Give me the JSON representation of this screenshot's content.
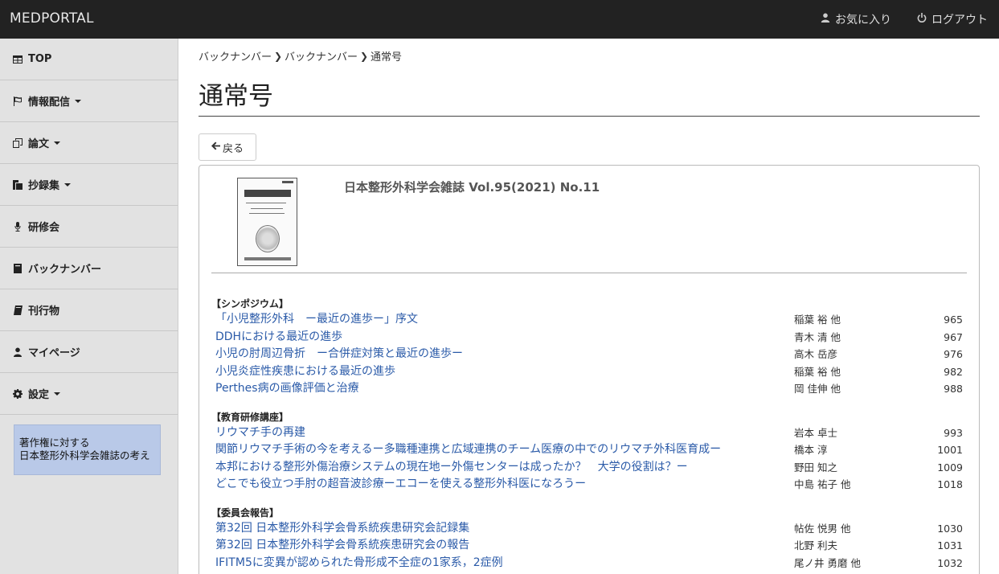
{
  "header": {
    "brand": "MEDPORTAL",
    "favorites_label": "お気に入り",
    "logout_label": "ログアウト"
  },
  "sidebar": {
    "items": [
      {
        "label": "TOP",
        "icon": "table-icon",
        "has_caret": false
      },
      {
        "label": "情報配信",
        "icon": "flag-icon",
        "has_caret": true
      },
      {
        "label": "論文",
        "icon": "copy-icon",
        "has_caret": true
      },
      {
        "label": "抄録集",
        "icon": "files-icon",
        "has_caret": true
      },
      {
        "label": "研修会",
        "icon": "microphone-icon",
        "has_caret": false
      },
      {
        "label": "バックナンバー",
        "icon": "book-icon",
        "has_caret": false
      },
      {
        "label": "刊行物",
        "icon": "book-open-icon",
        "has_caret": false
      },
      {
        "label": "マイページ",
        "icon": "user-icon",
        "has_caret": false
      },
      {
        "label": "設定",
        "icon": "gear-icon",
        "has_caret": true
      }
    ],
    "copyright_line1": "著作権に対する",
    "copyright_line2": "日本整形外科学会雑誌の考え"
  },
  "breadcrumb": [
    "バックナンバー",
    "バックナンバー",
    "通常号"
  ],
  "page_title": "通常号",
  "back_button": "戻る",
  "journal": {
    "title": "日本整形外科学会雑誌 Vol.95(2021) No.11"
  },
  "toc": [
    {
      "heading": "【シンポジウム】",
      "articles": [
        {
          "title": "「小児整形外科　ー最近の進歩ー」序文",
          "authors": "稲葉 裕 他",
          "page": "965"
        },
        {
          "title": "DDHにおける最近の進歩",
          "authors": "青木 清 他",
          "page": "967"
        },
        {
          "title": "小児の肘周辺骨折　ー合併症対策と最近の進歩ー",
          "authors": "高木 岳彦",
          "page": "976"
        },
        {
          "title": "小児炎症性疾患における最近の進歩",
          "authors": "稲葉 裕 他",
          "page": "982"
        },
        {
          "title": "Perthes病の画像評価と治療",
          "authors": "岡 佳伸 他",
          "page": "988"
        }
      ]
    },
    {
      "heading": "【教育研修講座】",
      "articles": [
        {
          "title": "リウマチ手の再建",
          "authors": "岩本 卓士",
          "page": "993"
        },
        {
          "title": "関節リウマチ手術の今を考えるー多職種連携と広域連携のチーム医療の中でのリウマチ外科医育成ー",
          "authors": "橋本 淳",
          "page": "1001"
        },
        {
          "title": "本邦における整形外傷治療システムの現在地ー外傷センターは成ったか？　大学の役割は？ー",
          "authors": "野田 知之",
          "page": "1009"
        },
        {
          "title": "どこでも役立つ手肘の超音波診療ーエコーを使える整形外科医になろうー",
          "authors": "中島 祐子 他",
          "page": "1018"
        }
      ]
    },
    {
      "heading": "【委員会報告】",
      "articles": [
        {
          "title": "第32回 日本整形外科学会骨系統疾患研究会記録集",
          "authors": "帖佐 悦男 他",
          "page": "1030"
        },
        {
          "title": "第32回 日本整形外科学会骨系統疾患研究会の報告",
          "authors": "北野 利夫",
          "page": "1031"
        },
        {
          "title": "IFITM5に変異が認められた骨形成不全症の1家系，2症例",
          "authors": "尾ノ井 勇磨 他",
          "page": "1032"
        }
      ]
    }
  ]
}
